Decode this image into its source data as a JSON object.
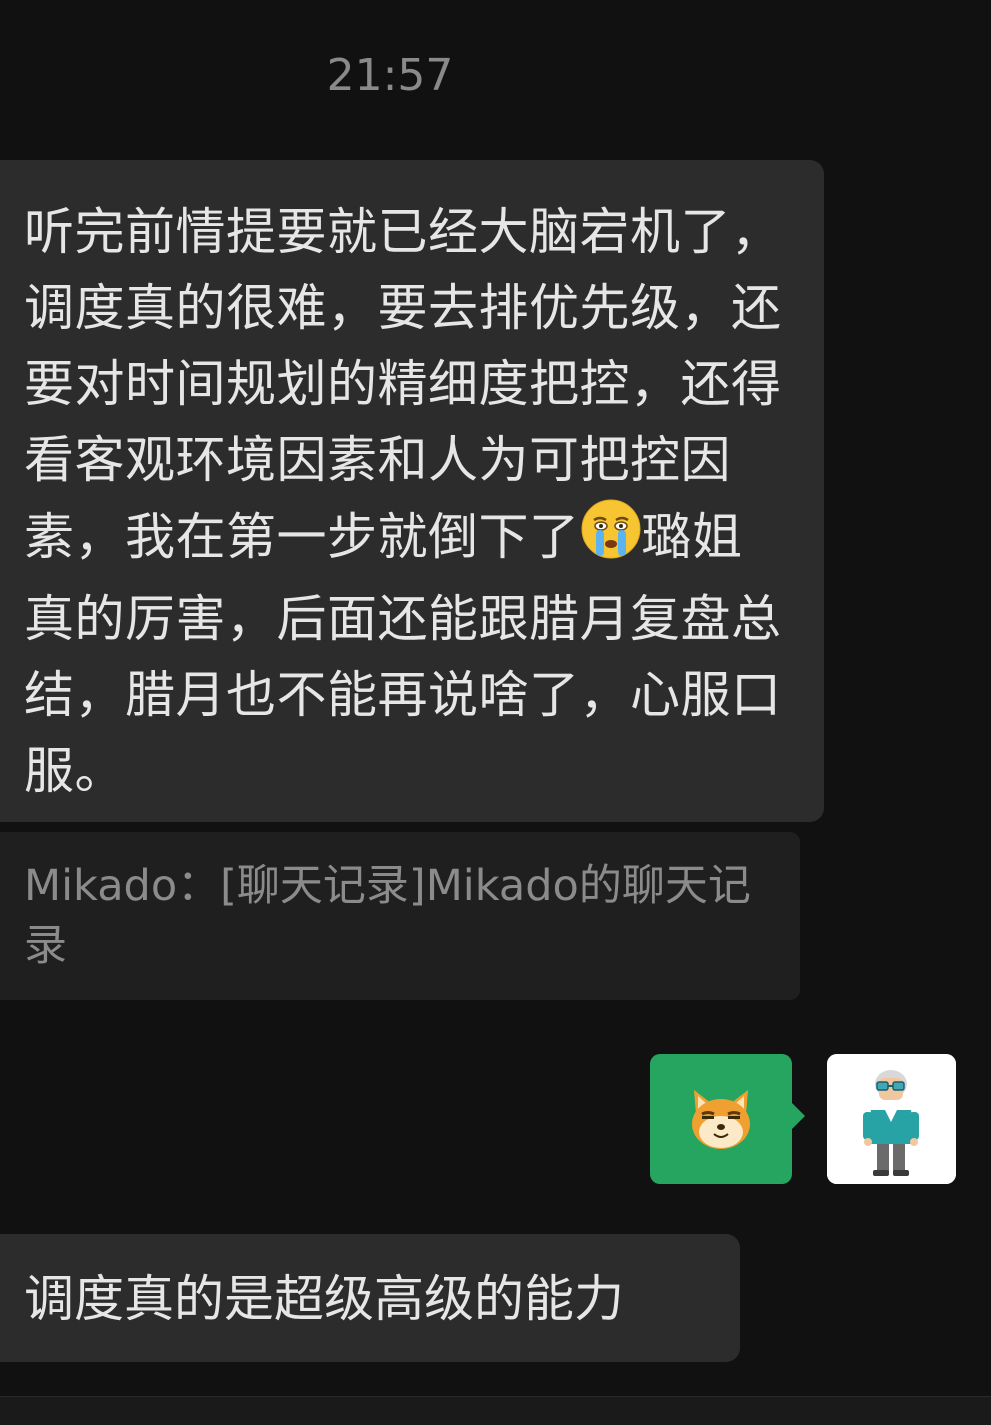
{
  "chat": {
    "timestamp": "21:57",
    "messages": [
      {
        "side": "incoming",
        "text_before_emoji": "听完前情提要就已经大脑宕机了，调度真的很难，要去排优先级，还要对时间规划的精细度把控，还得看客观环境因素和人为可把控因素，我在第一步就倒下了",
        "emoji": "crying-face-icon",
        "text_after_emoji": "璐姐真的厉害，后面还能跟腊月复盘总结，腊月也不能再说啥了，心服口服。"
      },
      {
        "side": "incoming-quote",
        "text": "Mikado：[聊天记录]Mikado的聊天记录"
      },
      {
        "side": "outgoing",
        "sticker": "shiba-doge-sticker-icon",
        "bubble_color": "#25a55f"
      },
      {
        "side": "incoming",
        "text": "调度真的是超级高级的能力"
      }
    ],
    "self_avatar": "old-man-avatar-icon"
  },
  "colors": {
    "background": "#111111",
    "incoming_bubble": "#2c2c2c",
    "quote_bubble": "#1f1f1f",
    "outgoing_bubble": "#25a55f",
    "timestamp_text": "#8a8a8a"
  }
}
